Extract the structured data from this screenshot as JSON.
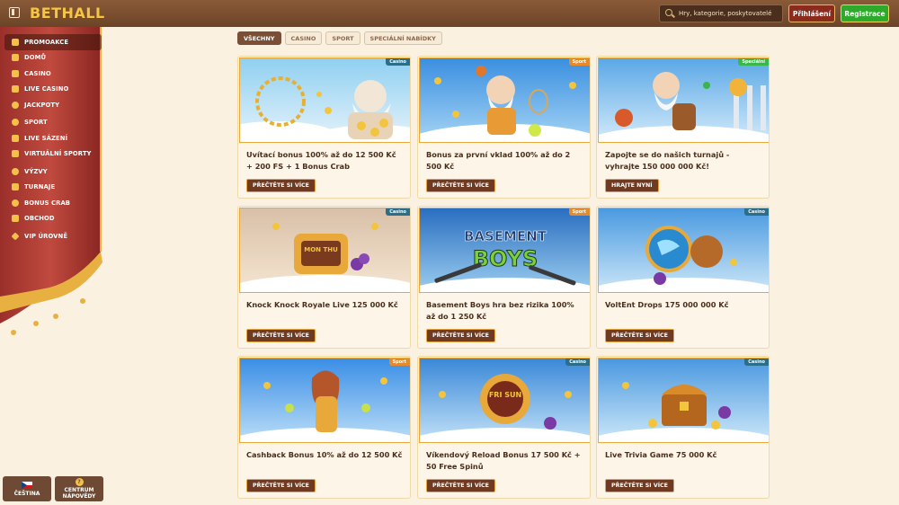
{
  "header": {
    "logo": "BETHALL",
    "search_placeholder": "Hry, kategorie, poskytovatelé",
    "login_label": "Přihlášení",
    "register_label": "Registrace"
  },
  "sidebar": {
    "items": [
      {
        "label": "PROMOAKCE",
        "icon": "gift-icon",
        "active": true
      },
      {
        "label": "DOMŮ",
        "icon": "home-icon"
      },
      {
        "label": "CASINO",
        "icon": "cards-icon"
      },
      {
        "label": "LIVE CASINO",
        "icon": "live-icon"
      },
      {
        "label": "JACKPOTY",
        "icon": "jackpot-icon"
      },
      {
        "label": "SPORT",
        "icon": "ball-icon"
      },
      {
        "label": "LIVE SÁZENÍ",
        "icon": "live-bet-icon"
      },
      {
        "label": "VIRTUÁLNÍ SPORTY",
        "icon": "virtual-icon"
      },
      {
        "label": "VÝZVY",
        "icon": "challenge-icon"
      },
      {
        "label": "TURNAJE",
        "icon": "trophy-icon"
      },
      {
        "label": "BONUS CRAB",
        "icon": "crab-icon"
      },
      {
        "label": "OBCHOD",
        "icon": "shop-icon"
      },
      {
        "label": "VIP ÚROVNĚ",
        "icon": "diamond-icon"
      }
    ],
    "language_label": "ČEŠTINA",
    "help_label": "CENTRUM NÁPOVĚDY"
  },
  "filters": [
    "VŠECHNY",
    "CASINO",
    "SPORT",
    "SPECIÁLNÍ NABÍDKY"
  ],
  "cards": [
    {
      "tag": "Casino",
      "title": "Uvítací bonus 100% až do 12 500 Kč + 200 FS + 1 Bonus Crab",
      "button": "PŘEČTĚTE SI VÍCE"
    },
    {
      "tag": "Sport",
      "title": "Bonus za první vklad 100% až do 2 500 Kč",
      "button": "PŘEČTĚTE SI VÍCE"
    },
    {
      "tag": "Speciální",
      "title": "Zapojte se do našich turnajů - vyhrajte 150 000 000 Kč!",
      "button": "HRAJTE NYNÍ"
    },
    {
      "tag": "Casino",
      "title": "Knock Knock Royale Live 125 000 Kč",
      "button": "PŘEČTĚTE SI VÍCE"
    },
    {
      "tag": "Sport",
      "title": "Basement Boys hra bez rizika 100% až do 1 250 Kč",
      "button": "PŘEČTĚTE SI VÍCE"
    },
    {
      "tag": "Casino",
      "title": "VoltEnt Drops 175 000 000 Kč",
      "button": "PŘEČTĚTE SI VÍCE"
    },
    {
      "tag": "Sport",
      "title": "Cashback Bonus 10% až do 12 500 Kč",
      "button": "PŘEČTĚTE SI VÍCE"
    },
    {
      "tag": "Casino",
      "title": "Víkendový Reload Bonus 17 500 Kč + 50 Free Spinů",
      "button": "PŘEČTĚTE SI VÍCE"
    },
    {
      "tag": "Casino",
      "title": "Live Trivia Game 75 000 Kč",
      "button": "PŘEČTĚTE SI VÍCE"
    }
  ],
  "images": {
    "basement_boys_line1": "BASEMENT",
    "basement_boys_line2": "BOYS",
    "mon_thu": "MON THU",
    "fri_sun": "FRI SUN"
  }
}
